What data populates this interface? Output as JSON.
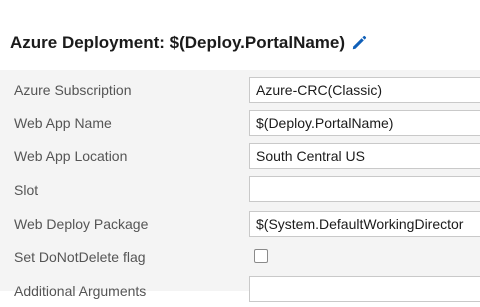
{
  "header": {
    "title": "Azure Deployment: $(Deploy.PortalName)",
    "edit_icon": "pencil-icon"
  },
  "form": {
    "fields": [
      {
        "label": "Azure Subscription",
        "value": "Azure-CRC(Classic)",
        "type": "select"
      },
      {
        "label": "Web App Name",
        "value": "$(Deploy.PortalName)",
        "type": "text"
      },
      {
        "label": "Web App Location",
        "value": "South Central US",
        "type": "select"
      },
      {
        "label": "Slot",
        "value": "",
        "type": "text"
      },
      {
        "label": "Web Deploy Package",
        "value": "$(System.DefaultWorkingDirector",
        "type": "text"
      },
      {
        "label": "Set DoNotDelete flag",
        "checked": false,
        "type": "checkbox"
      },
      {
        "label": "Additional Arguments",
        "value": "",
        "type": "text"
      }
    ]
  },
  "colors": {
    "accent": "#0f5fb8",
    "form_background": "#f4f4f4",
    "label_text": "#555555",
    "field_border": "#c9c9c9"
  }
}
